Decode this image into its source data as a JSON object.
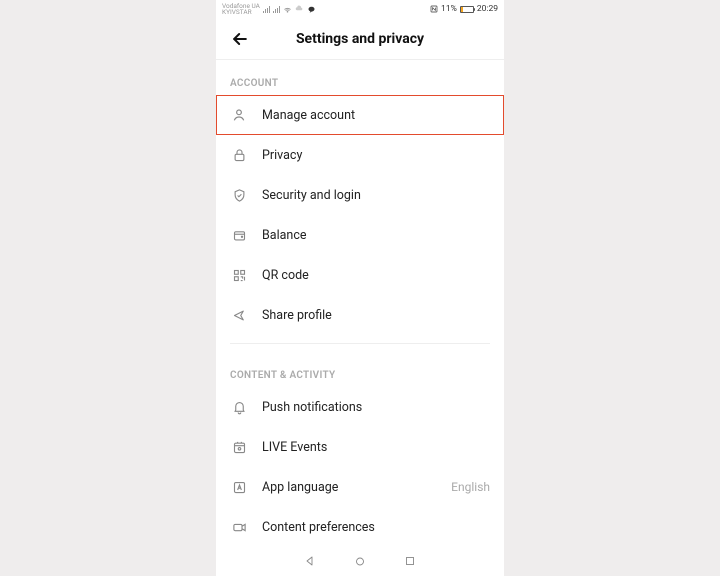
{
  "statusbar": {
    "carrier1": "Vodafone UA",
    "carrier2": "KYIVSTAR",
    "battery_pct": "11%",
    "time": "20:29"
  },
  "header": {
    "title": "Settings and privacy"
  },
  "sections": {
    "account_title": "ACCOUNT",
    "content_title": "CONTENT & ACTIVITY"
  },
  "rows": {
    "manage_account": "Manage account",
    "privacy": "Privacy",
    "security": "Security and login",
    "balance": "Balance",
    "qr": "QR code",
    "share": "Share profile",
    "push": "Push notifications",
    "live": "LIVE Events",
    "language": "App language",
    "language_value": "English",
    "content_pref": "Content preferences"
  }
}
